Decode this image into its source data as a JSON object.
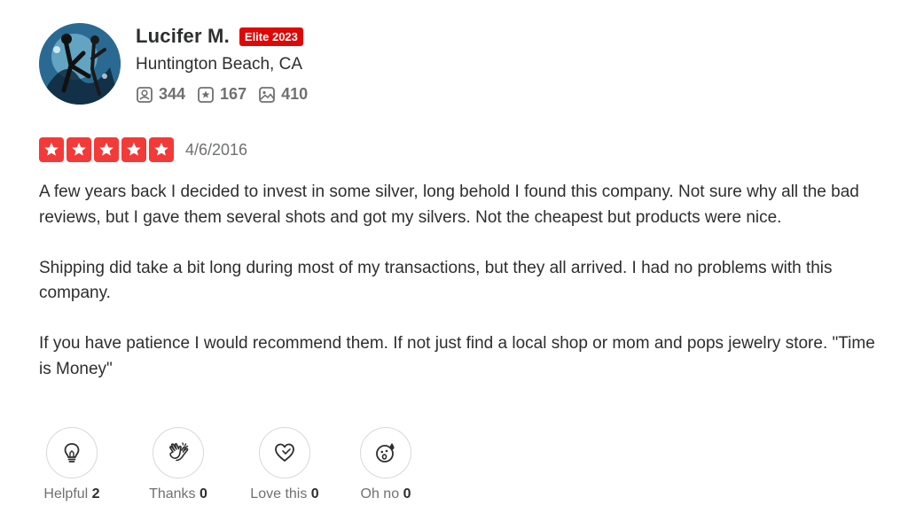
{
  "user": {
    "name": "Lucifer M.",
    "elite_badge": "Elite 2023",
    "location": "Huntington Beach, CA",
    "stats": {
      "friends": "344",
      "reviews": "167",
      "photos": "410"
    }
  },
  "review": {
    "rating": 5,
    "date": "4/6/2016",
    "paragraphs": [
      "A few years back I decided to invest in some silver, long behold I found this company. Not sure why all the bad reviews, but I gave them several shots and got my silvers. Not the cheapest but products were nice.",
      "Shipping did take a bit long during most of my transactions, but they all arrived. I had no problems with this company.",
      "If you have patience I would recommend them. If not just find a local shop or mom and pops jewelry store. \"Time is Money\""
    ]
  },
  "reactions": [
    {
      "label": "Helpful",
      "count": "2",
      "icon": "lightbulb-icon"
    },
    {
      "label": "Thanks",
      "count": "0",
      "icon": "clapping-hands-icon"
    },
    {
      "label": "Love this",
      "count": "0",
      "icon": "heart-icon"
    },
    {
      "label": "Oh no",
      "count": "0",
      "icon": "oh-no-face-icon"
    }
  ],
  "colors": {
    "star_red": "#f43939",
    "elite_red": "#e00707",
    "text_dark": "#2d2e2f",
    "text_gray": "#6e7072"
  }
}
